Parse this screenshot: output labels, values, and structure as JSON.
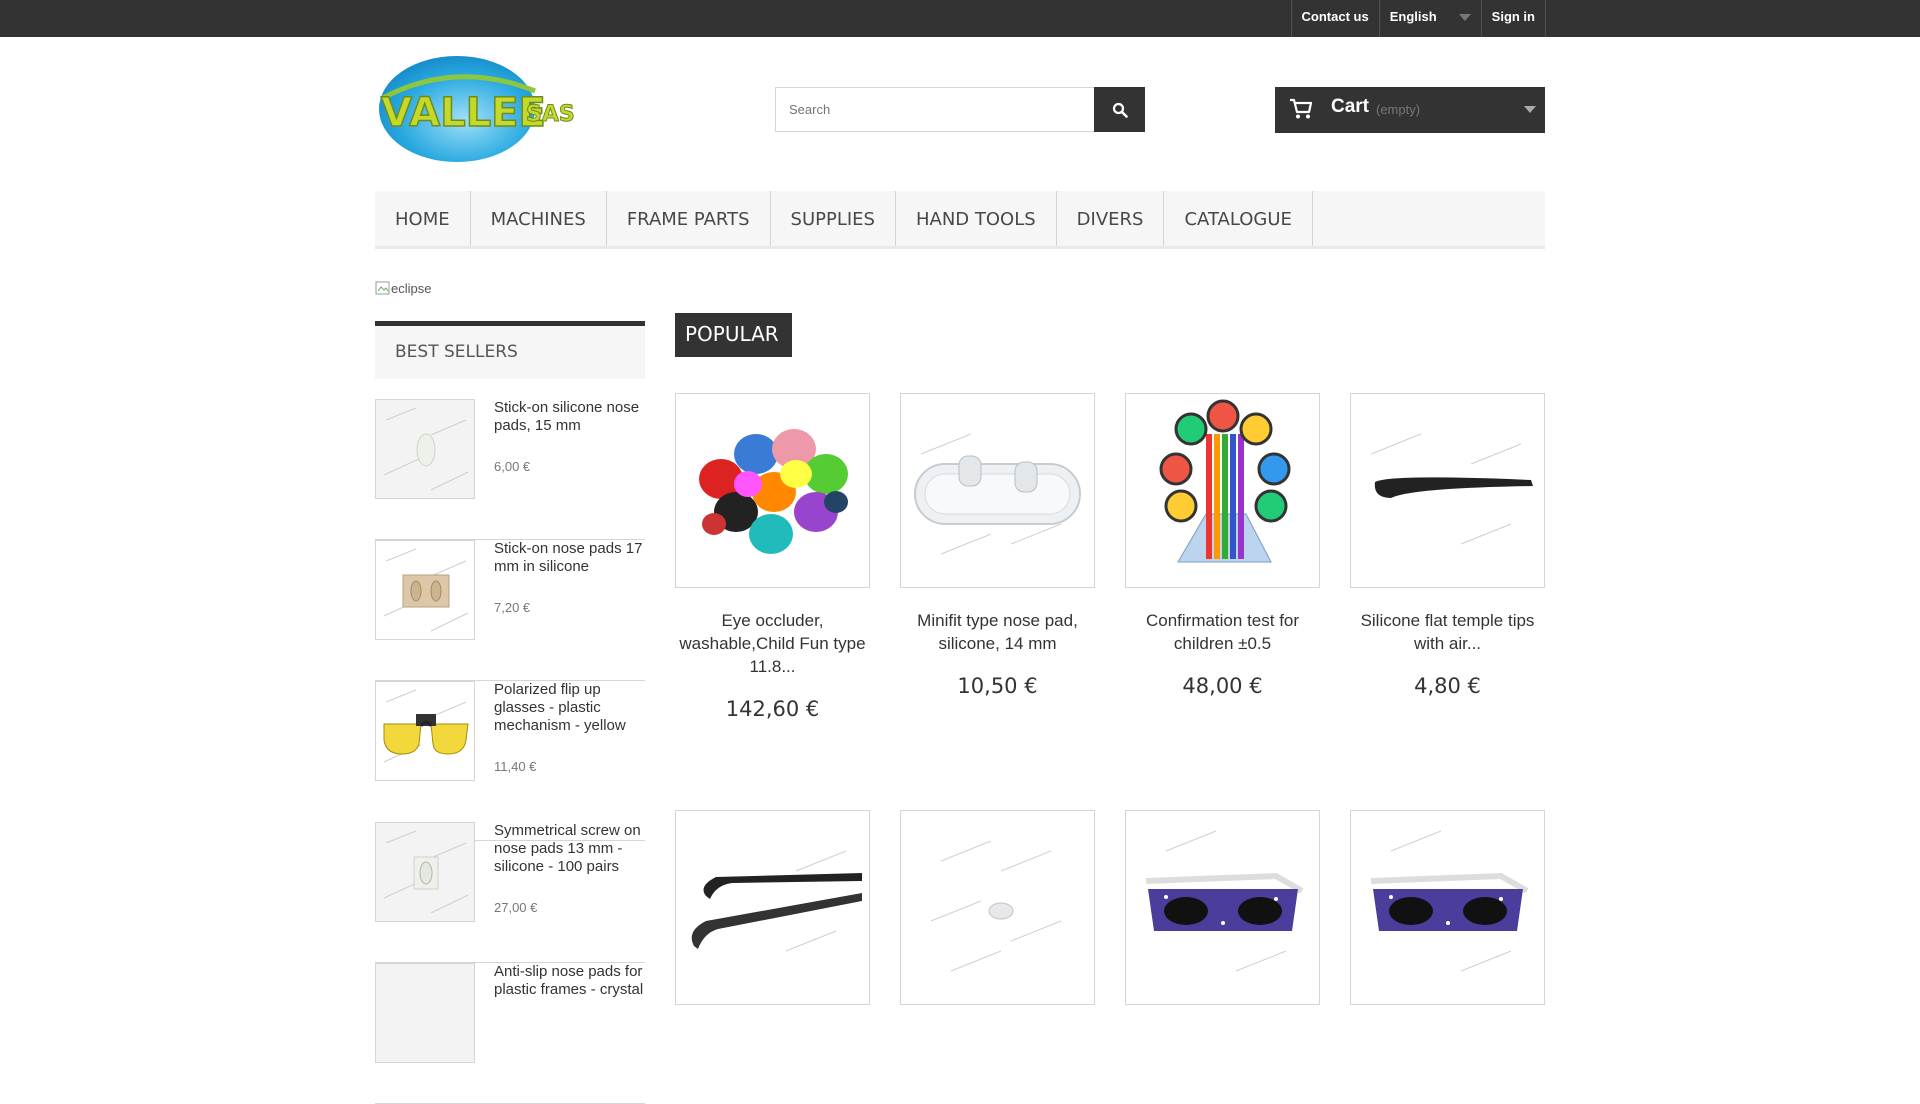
{
  "topbar": {
    "contact": "Contact us",
    "language": "English",
    "signin": "Sign in"
  },
  "logo": {
    "word1": "VALLEE",
    "word2": "SAS"
  },
  "search": {
    "placeholder": "Search",
    "icon": "search-icon"
  },
  "cart": {
    "label": "Cart",
    "status": "(empty)",
    "icon": "shopping-cart-icon"
  },
  "menu": [
    "HOME",
    "MACHINES",
    "FRAME PARTS",
    "SUPPLIES",
    "HAND TOOLS",
    "DIVERS",
    "CATALOGUE"
  ],
  "banner_alt": "eclipse",
  "bestsellers": {
    "title": "BEST SELLERS",
    "items": [
      {
        "name": "Stick-on silicone nose pads, 15 mm",
        "price": "6,00 €"
      },
      {
        "name": "Stick-on nose pads 17 mm in silicone",
        "price": "7,20 €"
      },
      {
        "name": "Polarized flip up glasses - plastic mechanism - yellow",
        "price": "11,40 €"
      },
      {
        "name": "Symmetrical screw on nose pads 13 mm - silicone - 100 pairs",
        "price": "27,00 €"
      },
      {
        "name": "Anti-slip nose pads for plastic frames - crystal",
        "price": ""
      }
    ]
  },
  "popular": {
    "tab": "POPULAR",
    "products": [
      {
        "name": "Eye occluder, washable,Child Fun type 11.8...",
        "price": "142,60 €"
      },
      {
        "name": "Minifit type nose pad, silicone, 14 mm",
        "price": "10,50 €"
      },
      {
        "name": "Confirmation test for children ±0.5",
        "price": "48,00 €"
      },
      {
        "name": "Silicone flat temple tips with air...",
        "price": "4,80 €"
      },
      {
        "name": "",
        "price": ""
      },
      {
        "name": "",
        "price": ""
      },
      {
        "name": "",
        "price": ""
      },
      {
        "name": "",
        "price": ""
      }
    ]
  },
  "colors": {
    "topbar": "#333333",
    "logo_green": "#8dc63f",
    "logo_blue": "#29a9e0",
    "menu_bg": "#f6f6f6"
  }
}
